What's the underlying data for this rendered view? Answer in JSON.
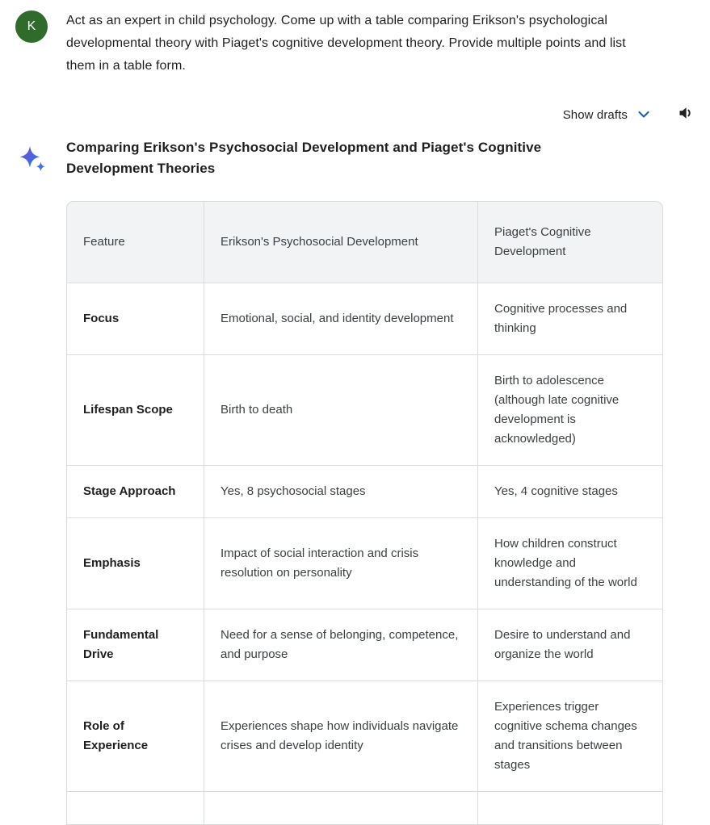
{
  "user": {
    "avatar_initial": "K",
    "avatar_color": "#2f6b2a",
    "prompt": "Act as an expert in child psychology. Come up with a table comparing Erikson's psychological developmental theory with Piaget's cognitive development theory. Provide multiple points and list them in a table form."
  },
  "controls": {
    "show_drafts_label": "Show drafts",
    "chevron_icon": "chevron-down-icon",
    "chevron_color": "#1a5fb4",
    "speaker_icon": "speaker-icon",
    "speaker_color": "#202124"
  },
  "response": {
    "sparkle_icon": "gemini-sparkle-icon",
    "sparkle_gradient_from": "#7a4fd6",
    "sparkle_gradient_to": "#2f7cf6",
    "heading": "Comparing Erikson's Psychosocial Development and Piaget's Cognitive Development Theories"
  },
  "table": {
    "headers": [
      "Feature",
      "Erikson's Psychosocial Development",
      "Piaget's Cognitive Development"
    ],
    "header_background": "#f1f3f4",
    "border_color": "#dadce0",
    "rows": [
      {
        "feature": "Focus",
        "erikson": "Emotional, social, and identity development",
        "piaget": "Cognitive processes and thinking"
      },
      {
        "feature": "Lifespan Scope",
        "erikson": "Birth to death",
        "piaget": "Birth to adolescence (although late cognitive development is acknowledged)"
      },
      {
        "feature": "Stage Approach",
        "erikson": "Yes, 8 psychosocial stages",
        "piaget": "Yes, 4 cognitive stages"
      },
      {
        "feature": "Emphasis",
        "erikson": "Impact of social interaction and crisis resolution on personality",
        "piaget": "How children construct knowledge and understanding of the world"
      },
      {
        "feature": "Fundamental Drive",
        "erikson": "Need for a sense of belonging, competence, and purpose",
        "piaget": "Desire to understand and organize the world"
      },
      {
        "feature": "Role of Experience",
        "erikson": "Experiences shape how individuals navigate crises and develop identity",
        "piaget": "Experiences trigger cognitive schema changes and transitions between stages"
      },
      {
        "feature": "",
        "erikson": "",
        "piaget": ""
      }
    ]
  }
}
